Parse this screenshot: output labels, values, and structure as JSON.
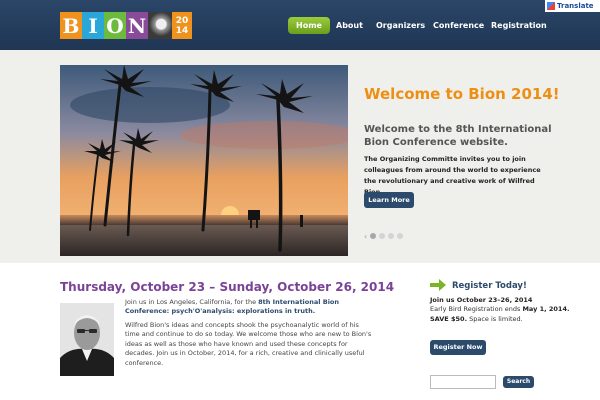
{
  "logo": {
    "letters": [
      "B",
      "I",
      "O",
      "N"
    ],
    "letter_colors": [
      "#f0931e",
      "#2aa7d8",
      "#6dbb3c",
      "#8a4a9a"
    ],
    "year_top": "20",
    "year_bottom": "14"
  },
  "nav": {
    "items": [
      {
        "label": "Home",
        "active": true
      },
      {
        "label": "About"
      },
      {
        "label": "Organizers"
      },
      {
        "label": "Conference"
      },
      {
        "label": "Registration"
      }
    ]
  },
  "translate": {
    "label": "Translate"
  },
  "welcome": {
    "title": "Welcome to Bion 2014!",
    "subtitle": "Welcome to the 8th International Bion Conference website.",
    "body": "The Organizing Committe invites you to join colleagues from around the world to experience the revolutionary and creative work of Wilfred Bion.",
    "button_label": "Learn More"
  },
  "slider": {
    "prev_arrow": "‹",
    "dot_count": 4,
    "active_index": 0
  },
  "main": {
    "date_heading": "Thursday, October 23 – Sunday, October 26, 2014",
    "para1_prefix": "Join us in Los Angeles, California, for the ",
    "para1_link": "8th International Bion Conference: psych'O'analysis: explorations in truth.",
    "para2": "Wilfred Bion's ideas and concepts shook the psychoanalytic world of his time and continue to do so today. We welcome those who are new to Bion's ideas as well as those who have known and used these concepts for decades. Join us in October, 2014, for a rich, creative and clinically useful conference."
  },
  "register": {
    "title": "Register Today!",
    "dates": "Join us October 23–26, 2014",
    "early_prefix": "Early Bird Registration ends ",
    "early_bold": "May 1, 2014. SAVE $50.",
    "early_suffix": " Space is limited.",
    "button_label": "Register Now"
  },
  "search": {
    "placeholder": "",
    "button_label": "Search"
  },
  "colors": {
    "header": "#23395a",
    "accent_orange": "#ee8f13",
    "accent_purple": "#7b4397",
    "button_blue": "#2c4a6c",
    "nav_active_green": "#7cb428"
  }
}
